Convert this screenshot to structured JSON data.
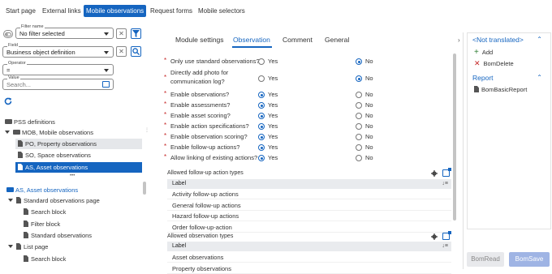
{
  "topnav": {
    "tabs": [
      {
        "label": "Start page"
      },
      {
        "label": "External links"
      },
      {
        "label": "Mobile observations"
      },
      {
        "label": "Request forms"
      },
      {
        "label": "Mobile selectors"
      }
    ],
    "active_index": 2
  },
  "filters": {
    "filter_name": {
      "legend": "Filter name",
      "value": "No filter selected"
    },
    "field": {
      "legend": "Field",
      "value": "Business object definition"
    },
    "operator": {
      "legend": "Operator",
      "value": "="
    },
    "value": {
      "legend": "Value",
      "placeholder": "Search..."
    }
  },
  "tree_top": [
    {
      "label": "PSS definitions"
    },
    {
      "label": "MOB, Mobile observations"
    },
    {
      "label": "PO, Property observations"
    },
    {
      "label": "SO, Space observations"
    },
    {
      "label": "AS, Asset observations"
    }
  ],
  "tree_bottom": [
    {
      "label": "AS, Asset observations"
    },
    {
      "label": "Standard observations page"
    },
    {
      "label": "Search block"
    },
    {
      "label": "Filter block"
    },
    {
      "label": "Standard observations"
    },
    {
      "label": "List page"
    },
    {
      "label": "Search block"
    }
  ],
  "center": {
    "tabs": [
      "Module settings",
      "Observation",
      "Comment",
      "General"
    ],
    "active_tab": "Observation",
    "yes_label": "Yes",
    "no_label": "No",
    "questions": [
      {
        "label": "Only use standard observations?",
        "selected": "No"
      },
      {
        "label": "Directly add photo for communication log?",
        "selected": "No"
      },
      {
        "label": "Enable observations?",
        "selected": "Yes"
      },
      {
        "label": "Enable assessments?",
        "selected": "Yes"
      },
      {
        "label": "Enable asset scoring?",
        "selected": "Yes"
      },
      {
        "label": "Enable action specifications?",
        "selected": "Yes"
      },
      {
        "label": "Enable observation scoring?",
        "selected": "Yes"
      },
      {
        "label": "Enable follow-up actions?",
        "selected": "Yes"
      },
      {
        "label": "Allow linking of existing actions?",
        "selected": "Yes"
      }
    ],
    "followup": {
      "title": "Allowed follow-up action types",
      "column": "Label",
      "rows": [
        "Activity follow-up actions",
        "General follow-up actions",
        "Hazard follow-up actions",
        "Order follow-up-action"
      ]
    },
    "obstypes": {
      "title": "Allowed observation types",
      "column": "Label",
      "rows": [
        "Asset observations",
        "Property observations"
      ]
    }
  },
  "right": {
    "section1": "<Not translated>",
    "items1": [
      {
        "label": "Add",
        "icon": "plus-icon",
        "color": "#2e7d32"
      },
      {
        "label": "BomDelete",
        "icon": "x-icon",
        "color": "#c62828"
      }
    ],
    "section2": "Report",
    "items2": [
      {
        "label": "BomBasicReport",
        "icon": "document-icon"
      }
    ],
    "buttons": {
      "read": "BomRead",
      "save": "BomSave"
    }
  },
  "colors": {
    "accent": "#1565c0",
    "required": "#c62828",
    "save_button": "#9fb4e4"
  }
}
